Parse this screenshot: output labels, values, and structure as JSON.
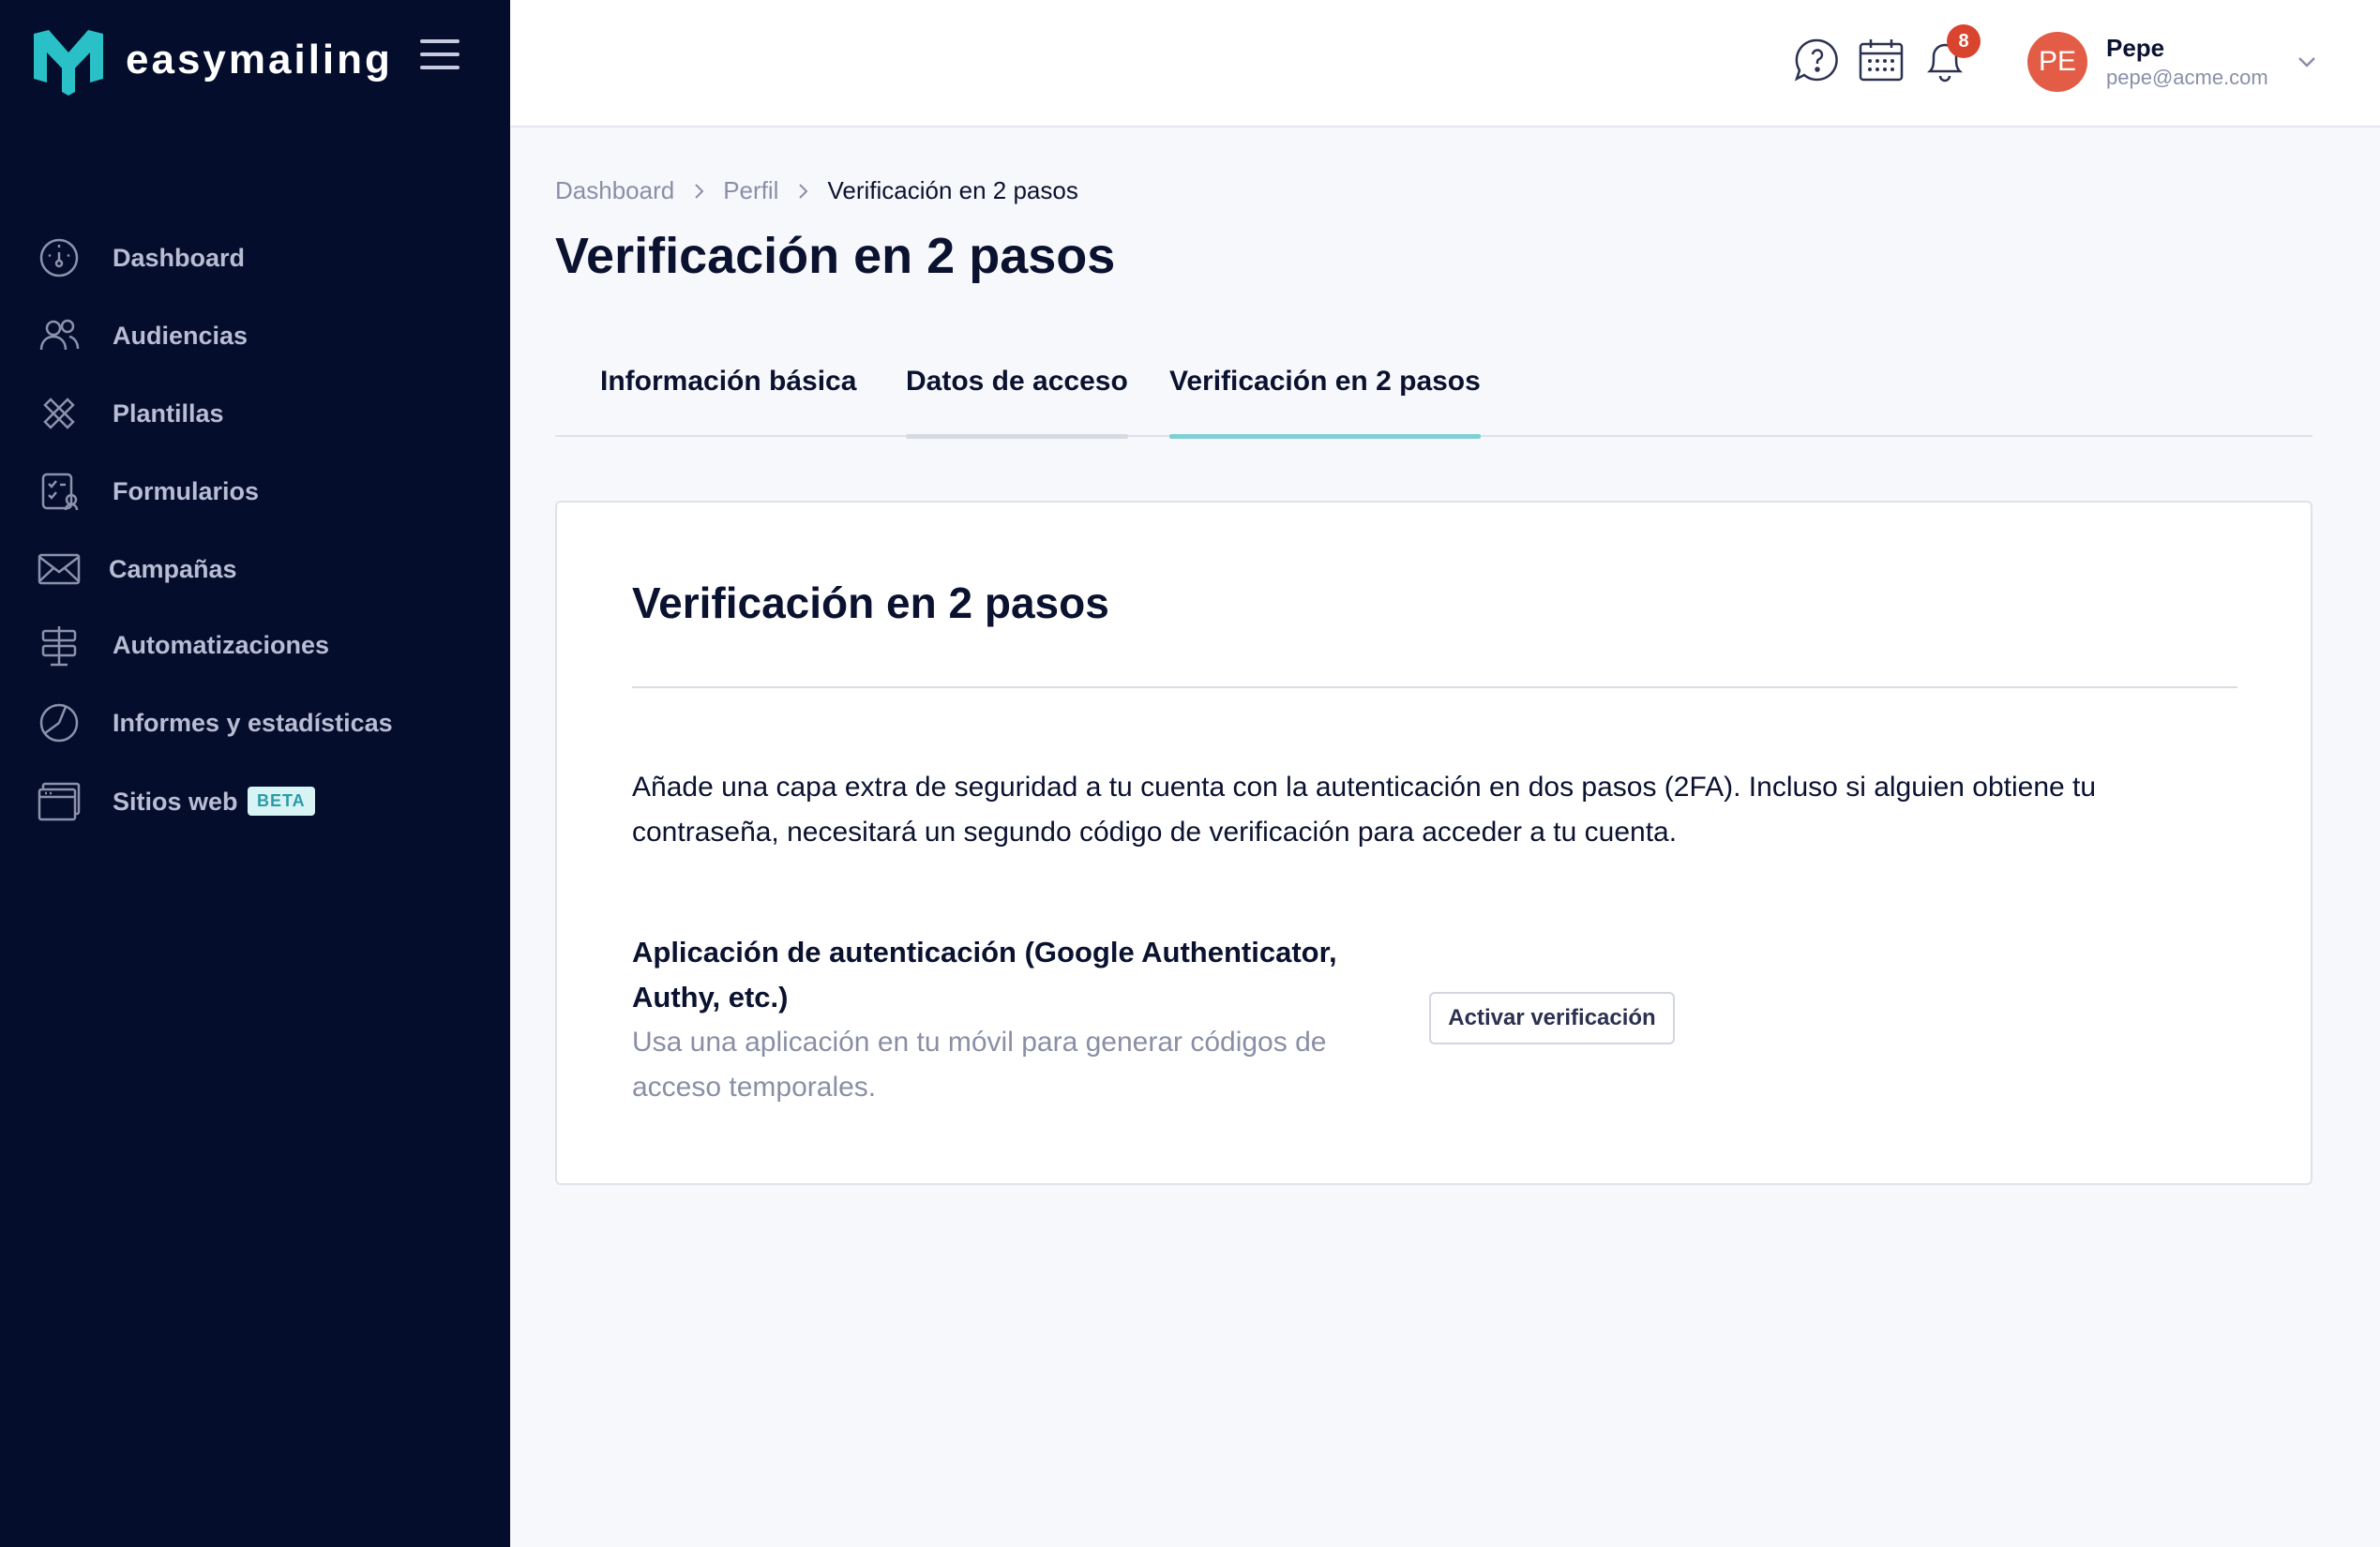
{
  "brand": {
    "name": "easymailing",
    "color": "#2ac0c8"
  },
  "sidebar": {
    "items": [
      {
        "label": "Dashboard",
        "icon": "dashboard-gauge-icon"
      },
      {
        "label": "Audiencias",
        "icon": "users-icon"
      },
      {
        "label": "Plantillas",
        "icon": "templates-icon"
      },
      {
        "label": "Formularios",
        "icon": "forms-icon"
      },
      {
        "label": "Campañas",
        "icon": "envelope-icon"
      },
      {
        "label": "Automatizaciones",
        "icon": "signpost-icon"
      },
      {
        "label": "Informes y estadísticas",
        "icon": "pie-chart-icon"
      },
      {
        "label": "Sitios web",
        "icon": "browser-window-icon",
        "badge": "BETA"
      }
    ]
  },
  "header": {
    "notifications_count": "8",
    "user": {
      "initials": "PE",
      "name": "Pepe",
      "email": "pepe@acme.com"
    }
  },
  "breadcrumb": {
    "items": [
      "Dashboard",
      "Perfil"
    ],
    "current": "Verificación en 2 pasos"
  },
  "page": {
    "title": "Verificación en 2 pasos"
  },
  "tabs": [
    {
      "label": "Información básica",
      "state": "normal"
    },
    {
      "label": "Datos de acceso",
      "state": "hover"
    },
    {
      "label": "Verificación en 2 pasos",
      "state": "active"
    }
  ],
  "card": {
    "title": "Verificación en 2 pasos",
    "description": "Añade una capa extra de seguridad a tu cuenta con la autenticación en dos pasos (2FA). Incluso si alguien obtiene tu contraseña, necesitará un segundo código de verificación para acceder a tu cuenta.",
    "method": {
      "title": "Aplicación de autenticación (Google Authenticator, Authy, etc.)",
      "description": "Usa una aplicación en tu móvil para generar códigos de acceso temporales.",
      "button_label": "Activar verificación"
    }
  },
  "colors": {
    "sidebar_bg": "#040d2b",
    "accent": "#2ac0c8",
    "tab_active_underline": "#7fcfd6",
    "tab_hover_underline": "#d7d9e4",
    "badge_red": "#d9442f",
    "avatar": "#e35d46"
  }
}
